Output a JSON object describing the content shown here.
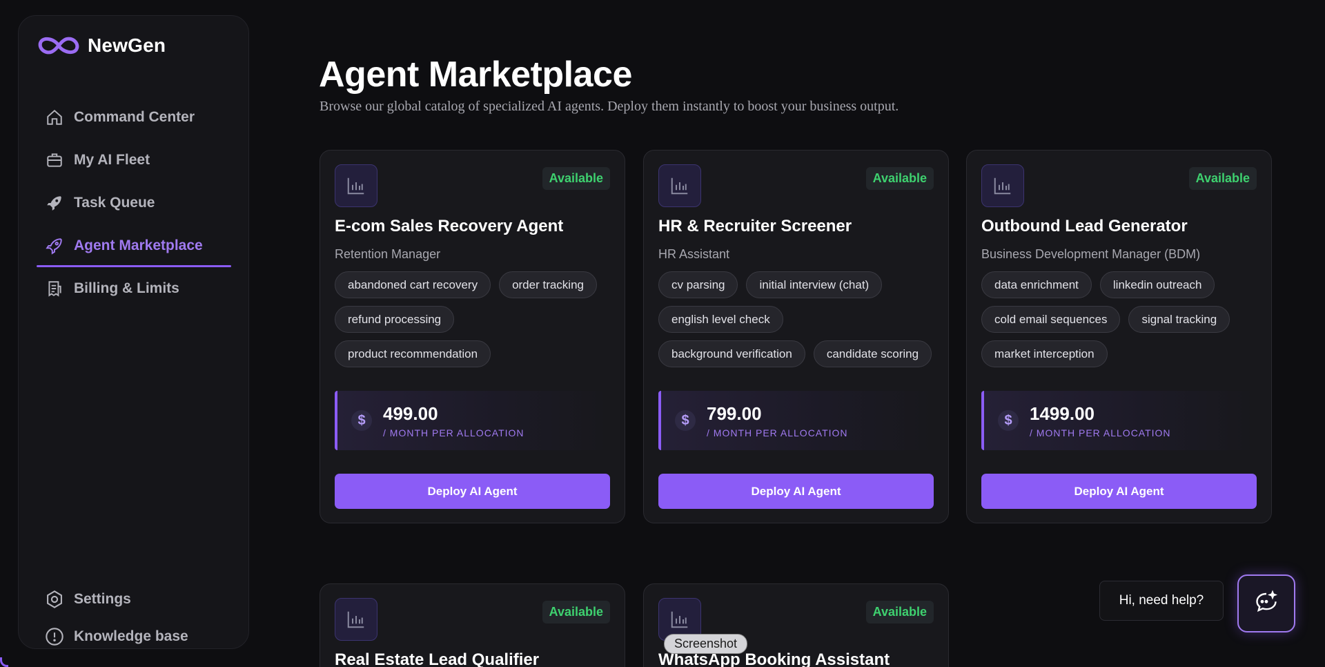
{
  "brand": {
    "name": "NewGen"
  },
  "nav": {
    "items": [
      {
        "label": "Command Center",
        "icon": "home-icon"
      },
      {
        "label": "My AI Fleet",
        "icon": "briefcase-icon"
      },
      {
        "label": "Task Queue",
        "icon": "rocket-icon"
      },
      {
        "label": "Agent Marketplace",
        "icon": "rocket-outline-icon",
        "active": true
      },
      {
        "label": "Billing & Limits",
        "icon": "receipt-icon"
      }
    ],
    "bottom": [
      {
        "label": "Settings",
        "icon": "settings-icon"
      },
      {
        "label": "Knowledge base",
        "icon": "info-icon"
      }
    ]
  },
  "page": {
    "title": "Agent Marketplace",
    "subtitle": "Browse our global catalog of specialized AI agents. Deploy them instantly to boost your business output."
  },
  "cards": [
    {
      "status": "Available",
      "name": "E-com Sales Recovery Agent",
      "role": "Retention Manager",
      "tags": [
        "abandoned cart recovery",
        "order tracking",
        "refund processing",
        "product recommendation"
      ],
      "price": "499.00",
      "price_unit": "/ MONTH PER ALLOCATION",
      "button": "Deploy AI Agent"
    },
    {
      "status": "Available",
      "name": "HR & Recruiter Screener",
      "role": "HR Assistant",
      "tags": [
        "cv parsing",
        "initial interview (chat)",
        "english level check",
        "background verification",
        "candidate scoring"
      ],
      "price": "799.00",
      "price_unit": "/ MONTH PER ALLOCATION",
      "button": "Deploy AI Agent"
    },
    {
      "status": "Available",
      "name": "Outbound Lead Generator",
      "role": "Business Development Manager (BDM)",
      "tags": [
        "data enrichment",
        "linkedin outreach",
        "cold email sequences",
        "signal tracking",
        "market interception"
      ],
      "price": "1499.00",
      "price_unit": "/ MONTH PER ALLOCATION",
      "button": "Deploy AI Agent"
    },
    {
      "status": "Available",
      "name": "Real Estate Lead Qualifier"
    },
    {
      "status": "Available",
      "name": "WhatsApp Booking Assistant"
    }
  ],
  "help": {
    "text": "Hi, need help?"
  },
  "overlay": {
    "screenshot_label": "Screenshot"
  },
  "colors": {
    "accent": "#8b5cf6",
    "available": "#3ed16f",
    "background": "#0e0e11"
  }
}
